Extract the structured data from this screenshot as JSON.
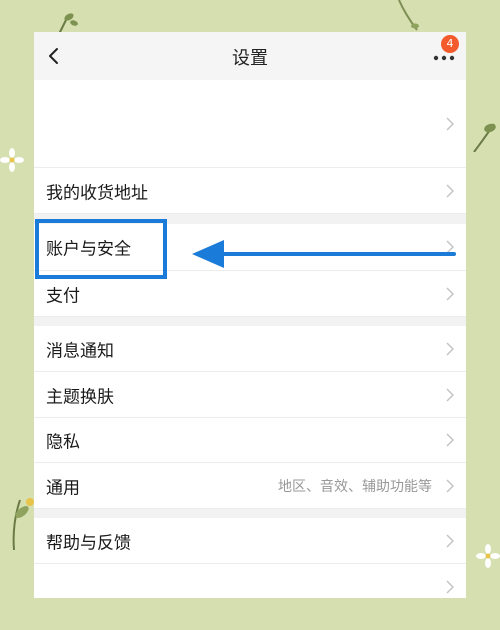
{
  "header": {
    "title": "设置",
    "badge_count": "4",
    "back_icon": "chevron-left-icon",
    "more_icon": "more-dots-icon"
  },
  "sections": [
    {
      "items": [
        {
          "label": "",
          "icon": "chevron-right-icon"
        },
        {
          "label": "我的收货地址",
          "icon": "chevron-right-icon"
        }
      ]
    },
    {
      "items": [
        {
          "label": "账户与安全",
          "icon": "chevron-right-icon",
          "highlighted": true
        },
        {
          "label": "支付",
          "icon": "chevron-right-icon"
        }
      ]
    },
    {
      "items": [
        {
          "label": "消息通知",
          "icon": "chevron-right-icon"
        },
        {
          "label": "主题换肤",
          "icon": "chevron-right-icon"
        },
        {
          "label": "隐私",
          "icon": "chevron-right-icon"
        },
        {
          "label": "通用",
          "value": "地区、音效、辅助功能等",
          "icon": "chevron-right-icon"
        }
      ]
    },
    {
      "items": [
        {
          "label": "帮助与反馈",
          "icon": "chevron-right-icon"
        },
        {
          "label": "",
          "icon": "chevron-right-icon"
        }
      ]
    }
  ],
  "annotation": {
    "arrow_color": "#1a7bd8",
    "arrow_icon": "arrow-left-icon"
  },
  "colors": {
    "background": "#d6dfb0",
    "badge": "#f35a2c",
    "highlight": "#1a7bd8"
  }
}
